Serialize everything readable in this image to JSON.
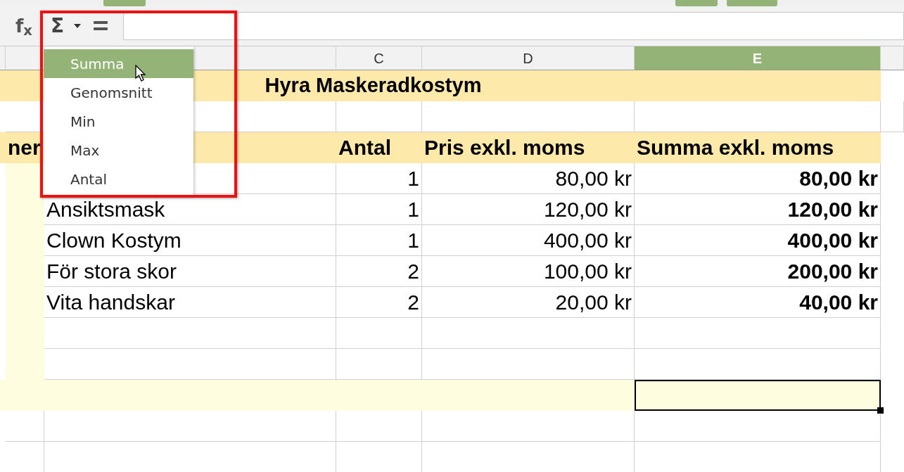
{
  "formula_bar": {
    "function_label": "f$_{x}$",
    "sum_symbol": "Σ"
  },
  "columns": [
    {
      "label": "C",
      "selected": false
    },
    {
      "label": "D",
      "selected": false
    },
    {
      "label": "E",
      "selected": true
    }
  ],
  "sheet": {
    "title": "Hyra Maskeradkostym",
    "header": {
      "column_a": "ner",
      "qty": "Antal",
      "price": "Pris exkl. moms",
      "total": "Summa exkl. moms"
    },
    "rows": [
      {
        "qty": "1",
        "price": "80,00 kr",
        "total": "80,00 kr"
      },
      {
        "item": "Ansiktsmask",
        "qty": "1",
        "price": "120,00 kr",
        "total": "120,00 kr"
      },
      {
        "item": "Clown Kostym",
        "qty": "1",
        "price": "400,00 kr",
        "total": "400,00 kr"
      },
      {
        "item": "För stora skor",
        "qty": "2",
        "price": "100,00 kr",
        "total": "200,00 kr"
      },
      {
        "item": "Vita handskar",
        "qty": "2",
        "price": "20,00 kr",
        "total": "40,00 kr"
      }
    ],
    "total_cell_selected": true
  },
  "menu": {
    "items": [
      {
        "label": "Summa",
        "selected": true
      },
      {
        "label": "Genomsnitt",
        "selected": false
      },
      {
        "label": "Min",
        "selected": false
      },
      {
        "label": "Max",
        "selected": false
      },
      {
        "label": "Antal",
        "selected": false
      }
    ]
  }
}
